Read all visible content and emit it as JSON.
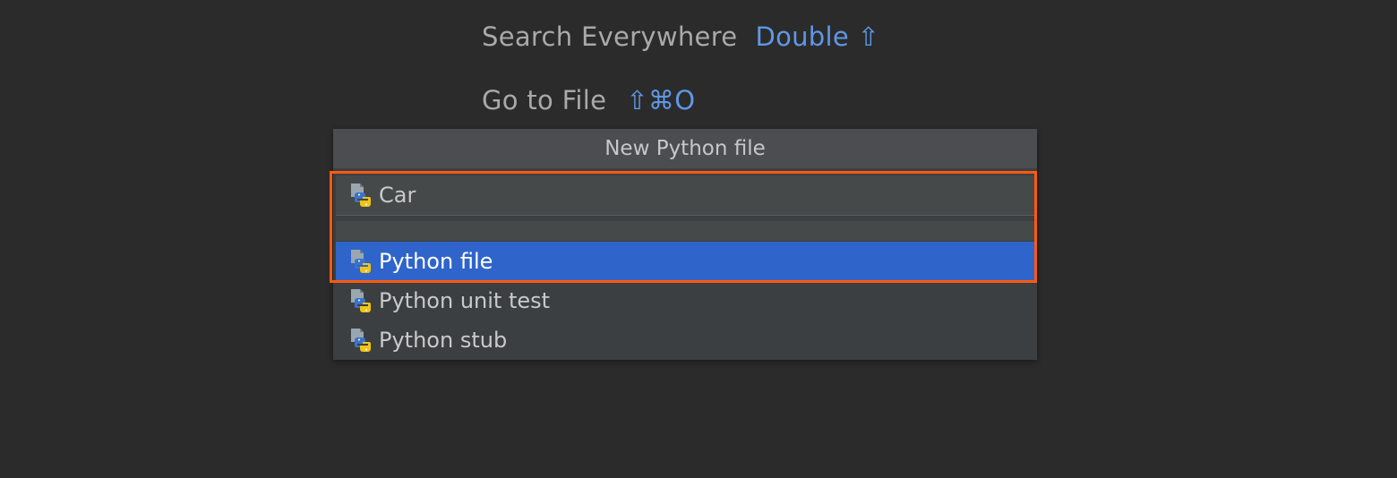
{
  "hints": {
    "search_label": "Search Everywhere",
    "search_shortcut": "Double ⇧",
    "goto_label": "Go to File",
    "goto_shortcut": "⇧⌘O"
  },
  "popup": {
    "title": "New Python file",
    "name_value": "Car",
    "items": [
      {
        "label": "Python file",
        "icon": "python-file-icon",
        "selected": true
      },
      {
        "label": "Python unit test",
        "icon": "python-file-icon",
        "selected": false
      },
      {
        "label": "Python stub",
        "icon": "python-file-icon",
        "selected": false
      }
    ]
  },
  "colors": {
    "background": "#2b2b2b",
    "popup_bg": "#3c3f41",
    "title_bg": "#4b4d50",
    "selection": "#2f65ca",
    "shortcut": "#5f97e6",
    "highlight": "#ff5a10"
  }
}
